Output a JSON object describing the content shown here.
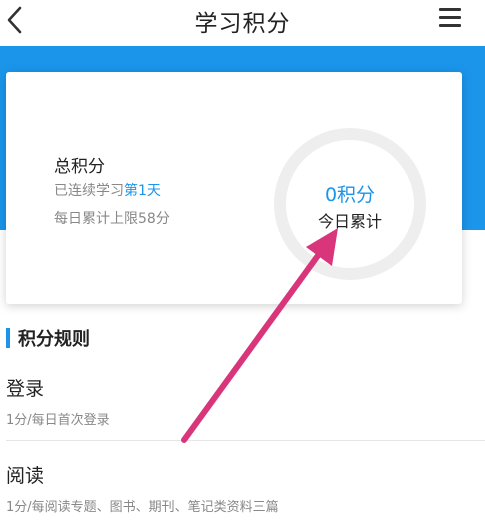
{
  "header": {
    "title": "学习积分",
    "back_icon": "chevron-left-icon",
    "menu_icon": "hamburger-menu-icon"
  },
  "summary": {
    "title": "总积分",
    "streak_prefix": "已连续学习",
    "streak_value": "第1天",
    "daily_limit": "每日累计上限58分",
    "today_points": "0积分",
    "today_label": "今日累计"
  },
  "rules": {
    "title": "积分规则",
    "items": [
      {
        "name": "登录",
        "desc": "1分/每日首次登录"
      },
      {
        "name": "阅读",
        "desc": "1分/每阅读专题、图书、期刊、笔记类资料三篇"
      }
    ]
  },
  "colors": {
    "accent": "#1b95ea",
    "annotation_arrow": "#d9357a",
    "ring": "#eeeeee"
  }
}
